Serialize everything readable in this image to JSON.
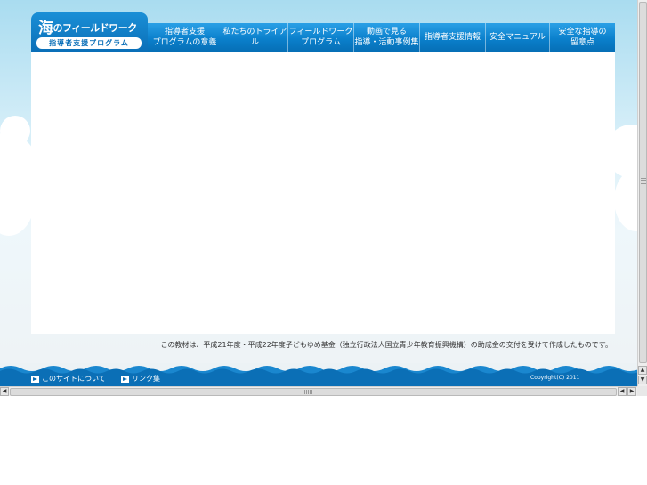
{
  "logo": {
    "title_big": "海",
    "title_rest": "のフィールドワーク",
    "subtitle": "指導者支援プログラム"
  },
  "nav": {
    "items": [
      {
        "label": "指導者支援\nプログラムの意義"
      },
      {
        "label": "私たちのトライアル"
      },
      {
        "label": "フィールドワーク\nプログラム"
      },
      {
        "label": "動画で見る\n指導・活動事例集"
      },
      {
        "label": "指導者支援情報"
      },
      {
        "label": "安全マニュアル"
      },
      {
        "label": "安全な指導の\n留意点"
      }
    ]
  },
  "notice": "この教材は、平成21年度・平成22年度子どもゆめ基金（独立行政法人国立青少年教育振興機構）の助成金の交付を受けて作成したものです。",
  "footer": {
    "links": [
      {
        "label": "このサイトについて"
      },
      {
        "label": "リンク集"
      }
    ],
    "copyright": "Copyright(C) 2011"
  },
  "colors": {
    "nav_blue": "#0b80cc",
    "footer_blue": "#0b6fb6",
    "sky": "#a9dcf0"
  }
}
